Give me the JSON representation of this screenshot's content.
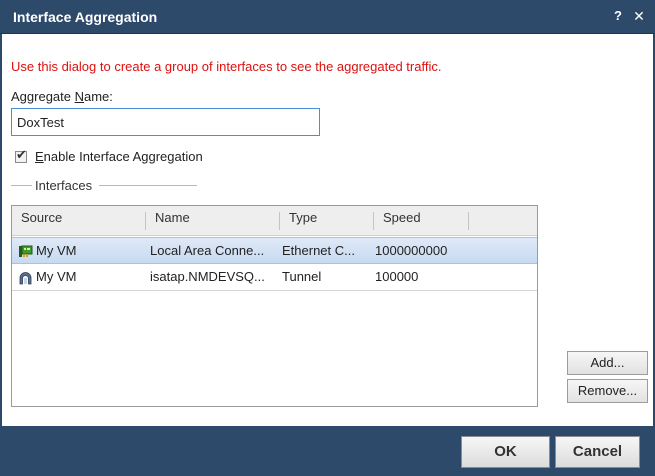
{
  "window": {
    "title": "Interface Aggregation",
    "help_label": "?",
    "close_label": "✕"
  },
  "intro_text": "Use this dialog to create a group of interfaces to see the aggregated traffic.",
  "aggregate": {
    "label_prefix": "Aggregate ",
    "label_accel": "N",
    "label_suffix": "ame:",
    "value": "DoxTest"
  },
  "enable": {
    "checked": true,
    "label_accel": "E",
    "label_rest": "nable Interface Aggregation"
  },
  "interfaces": {
    "title": "Interfaces",
    "columns": [
      "Source",
      "Name",
      "Type",
      "Speed"
    ],
    "rows": [
      {
        "source": "My VM",
        "name": "Local Area Conne...",
        "type": "Ethernet C...",
        "speed": "1000000000",
        "icon": "network-card-icon",
        "selected": true
      },
      {
        "source": "My VM",
        "name": "isatap.NMDEVSQ...",
        "type": "Tunnel",
        "speed": "100000",
        "icon": "tunnel-icon",
        "selected": false
      }
    ]
  },
  "side_buttons": {
    "add": "Add...",
    "remove": "Remove..."
  },
  "footer": {
    "ok": "OK",
    "cancel": "Cancel"
  }
}
